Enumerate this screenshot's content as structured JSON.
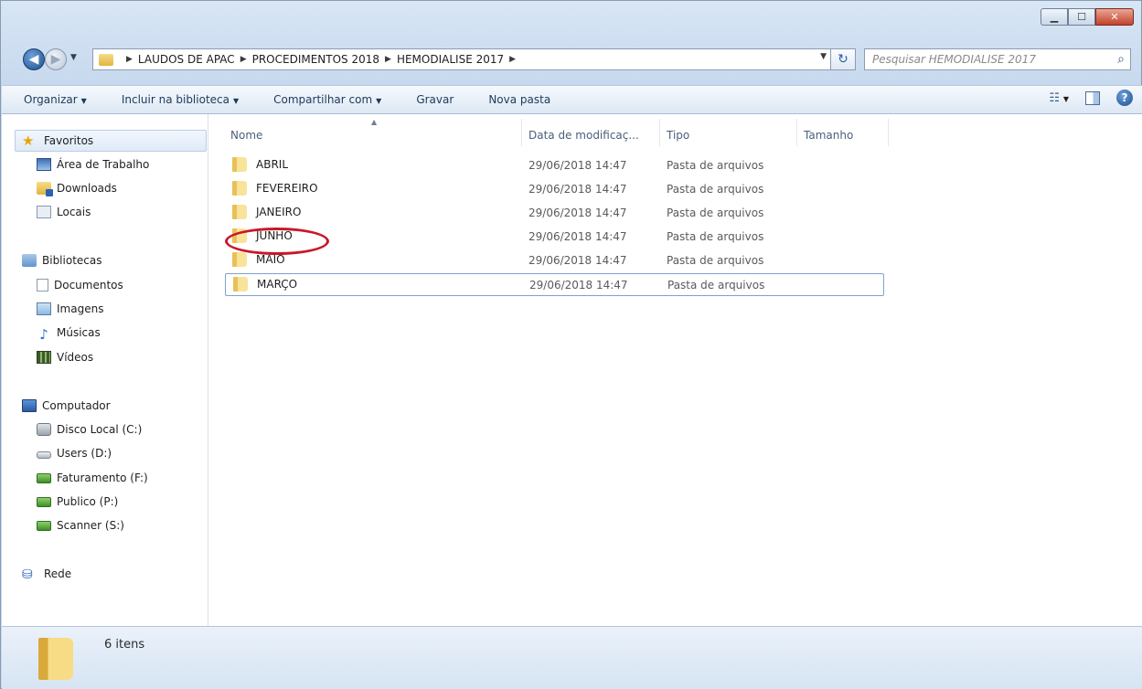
{
  "window": {
    "controls": {
      "minimize": "▁",
      "maximize": "☐",
      "close": "✕"
    }
  },
  "nav": {
    "back_icon": "◀",
    "forward_icon": "▶",
    "history_caret": "▼",
    "breadcrumb": [
      "LAUDOS DE APAC",
      "PROCEDIMENTOS 2018",
      "HEMODIALISE 2017"
    ],
    "separator": "▶",
    "address_dropdown": "▼",
    "refresh_icon": "↻",
    "search_placeholder": "Pesquisar HEMODIALISE 2017",
    "search_icon": "⌕"
  },
  "toolbar": {
    "organize": "Organizar",
    "include_library": "Incluir na biblioteca",
    "share": "Compartilhar com",
    "burn": "Gravar",
    "new_folder": "Nova pasta",
    "caret": "▼",
    "view_icon": "☷",
    "view_caret": "▼",
    "help": "?"
  },
  "sidebar": {
    "favorites": "Favoritos",
    "favorite_items": [
      "Área de Trabalho",
      "Downloads",
      "Locais"
    ],
    "libraries": "Bibliotecas",
    "library_items": [
      "Documentos",
      "Imagens",
      "Músicas",
      "Vídeos"
    ],
    "computer": "Computador",
    "computer_items": [
      "Disco Local (C:)",
      "Users (D:)",
      "Faturamento (F:)",
      "Publico (P:)",
      "Scanner (S:)"
    ],
    "network": "Rede"
  },
  "columns": {
    "name": "Nome",
    "date": "Data de modificaç...",
    "type": "Tipo",
    "size": "Tamanho",
    "sort_indicator": "▲"
  },
  "files": [
    {
      "name": "ABRIL",
      "date": "29/06/2018 14:47",
      "type": "Pasta de arquivos"
    },
    {
      "name": "FEVEREIRO",
      "date": "29/06/2018 14:47",
      "type": "Pasta de arquivos"
    },
    {
      "name": "JANEIRO",
      "date": "29/06/2018 14:47",
      "type": "Pasta de arquivos"
    },
    {
      "name": "JUNHO",
      "date": "29/06/2018 14:47",
      "type": "Pasta de arquivos"
    },
    {
      "name": "MAIO",
      "date": "29/06/2018 14:47",
      "type": "Pasta de arquivos"
    },
    {
      "name": "MARÇO",
      "date": "29/06/2018 14:47",
      "type": "Pasta de arquivos"
    }
  ],
  "status": {
    "item_count": "6 itens"
  },
  "colors": {
    "annotation_circle": "#c8182a",
    "accent": "#1e395b"
  }
}
